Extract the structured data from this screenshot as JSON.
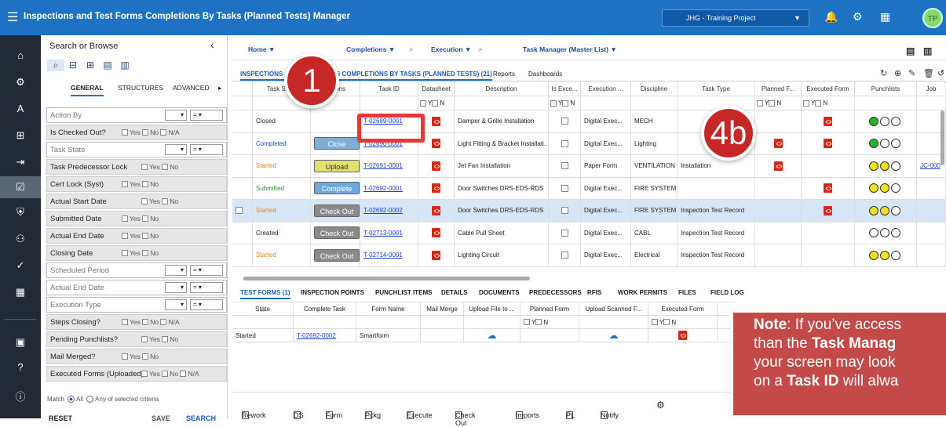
{
  "app": {
    "title": "Inspections and Test Forms Completions By Tasks (Planned Tests) Manager",
    "project": "JHG - Training Project",
    "avatar": "TP"
  },
  "search": {
    "header": "Search or Browse",
    "tabs": [
      "GENERAL",
      "STRUCTURES",
      "ADVANCED"
    ],
    "filters": [
      {
        "label": "Action By",
        "type": "input",
        "op": "="
      },
      {
        "label": "Is Checked Out?",
        "type": "yn",
        "na": true
      },
      {
        "label": "Task State",
        "type": "input",
        "op": "="
      },
      {
        "label": "Task Predecessor Lock",
        "type": "yn",
        "na": false
      },
      {
        "label": "Cert Lock (Syst)",
        "type": "yn",
        "na": false
      },
      {
        "label": "Actual Start Date",
        "type": "yn",
        "na": false
      },
      {
        "label": "Submitted Date",
        "type": "yn",
        "na": false
      },
      {
        "label": "Actual End Date",
        "type": "yn",
        "na": false
      },
      {
        "label": "Closing Date",
        "type": "yn",
        "na": false
      },
      {
        "label": "Scheduled Period",
        "type": "input",
        "op": "="
      },
      {
        "label": "Actual End Date",
        "type": "input",
        "op": "="
      },
      {
        "label": "Execution Type",
        "type": "input",
        "op": "="
      },
      {
        "label": "Steps Closing?",
        "type": "yn",
        "na": true
      },
      {
        "label": "Pending Punchlists?",
        "type": "yn",
        "na": false
      },
      {
        "label": "Mail Merged?",
        "type": "yn",
        "na": false
      },
      {
        "label": "Executed Forms (Uploaded)?",
        "type": "yn",
        "na": true
      }
    ],
    "yes": "Yes",
    "no": "No",
    "na": "N/A",
    "match": {
      "prefix": "Match",
      "all": "All",
      "any": "Any",
      "suffix": "of selected criteria"
    },
    "buttons": {
      "reset": "RESET",
      "save": "SAVE",
      "search": "SEARCH"
    }
  },
  "breadcrumbs": [
    "Home ▼",
    "Completions ▼",
    "Execution ▼",
    "Task Manager (Master List) ▼"
  ],
  "tabs": {
    "main": "INSPECTIONS AND TEST FORMS COMPLETIONS BY TASKS (PLANNED TESTS) (21)",
    "reports": "Reports",
    "dashboards": "Dashboards"
  },
  "grid": {
    "headers": [
      "Task State",
      "Actions",
      "Task ID",
      "Datasheet",
      "Description",
      "Is Exce...",
      "Execution ...",
      "Discipline",
      "Task Type",
      "Planned F...",
      "Executed Form",
      "Punchlists",
      "Job"
    ],
    "filter_yn": "Y",
    "filter_n": "N",
    "rows": [
      {
        "state": "Closed",
        "state_color": "#222",
        "action": "",
        "action_class": "",
        "task_id": "T-02689-0001",
        "description": "Damper & Grille Installation",
        "exec": "Digital Exec...",
        "discipline": "MECH",
        "task_type": "",
        "planned": false,
        "executed": true,
        "lights": [
          "lg",
          "",
          ""
        ],
        "job": ""
      },
      {
        "state": "Completed",
        "state_color": "#1d4ec4",
        "action": "Close",
        "action_class": "close",
        "task_id": "T-02690-0001",
        "description": "Light Fitting & Bracket Installati...",
        "exec": "Digital Exec...",
        "discipline": "Lighting",
        "task_type": "",
        "planned": true,
        "executed": true,
        "lights": [
          "lg",
          "",
          ""
        ],
        "job": ""
      },
      {
        "state": "Started",
        "state_color": "#e8801a",
        "action": "Upload",
        "action_class": "upload",
        "task_id": "T-02691-0001",
        "description": "Jet Fan Installation",
        "exec": "Paper Form",
        "discipline": "VENTILATION",
        "task_type": "Installation",
        "planned": true,
        "executed": false,
        "lights": [
          "ly",
          "ly",
          ""
        ],
        "job": "JC-000"
      },
      {
        "state": "Submitted",
        "state_color": "#2e8b2e",
        "action": "Complete",
        "action_class": "complete",
        "task_id": "T-02692-0001",
        "description": "Door Switches DRS-EDS-RDS",
        "exec": "Digital Exec...",
        "discipline": "FIRE SYSTEM",
        "task_type": "",
        "planned": false,
        "executed": true,
        "lights": [
          "ly",
          "ly",
          ""
        ],
        "job": ""
      },
      {
        "state": "Started",
        "state_color": "#e8801a",
        "action": "Check Out",
        "action_class": "check",
        "task_id": "T-02692-0002",
        "description": "Door Switches DRS-EDS-RDS",
        "exec": "Digital Exec...",
        "discipline": "FIRE SYSTEM",
        "task_type": "Inspection Test Record",
        "planned": false,
        "executed": true,
        "lights": [
          "ly",
          "ly",
          ""
        ],
        "job": "",
        "selected": true
      },
      {
        "state": "Created",
        "state_color": "#222",
        "action": "Check Out",
        "action_class": "check",
        "task_id": "T-02713-0001",
        "description": "Cable Pull Sheet",
        "exec": "Digital Exec...",
        "discipline": "CABL",
        "task_type": "Inspection Test Record",
        "planned": false,
        "executed": false,
        "lights": [
          "",
          "",
          ""
        ],
        "job": ""
      },
      {
        "state": "Started",
        "state_color": "#e8801a",
        "action": "Check Out",
        "action_class": "check",
        "task_id": "T-02714-0001",
        "description": "Lighting Circuit",
        "exec": "Digital Exec...",
        "discipline": "Electrical",
        "task_type": "Inspection Test Record",
        "planned": false,
        "executed": false,
        "lights": [
          "ly",
          "ly",
          ""
        ],
        "job": ""
      }
    ]
  },
  "bottom_tabs": [
    "TEST FORMS (1)",
    "INSPECTION POINTS",
    "PUNCHLIST ITEMS",
    "DETAILS",
    "DOCUMENTS",
    "PREDECESSORS",
    "RFIS",
    "WORK PERMITS",
    "FILES",
    "FIELD LOG"
  ],
  "bgrid": {
    "headers": [
      "State",
      "Complete Task",
      "Form Name",
      "Mail Merge",
      "Upload File to ...",
      "Planned Form",
      "Upload Scanned F...",
      "Executed Form"
    ],
    "row": {
      "state": "Started",
      "task": "T-02692-0002",
      "form": "Smartform"
    }
  },
  "toolbar": [
    "Rework",
    "DS",
    "Form",
    "Pckg",
    "Execute",
    "Check Out",
    "Imports",
    "PL",
    "Notify"
  ],
  "callouts": {
    "one": "1",
    "fourb": "4b"
  },
  "note": {
    "l1a": "Note",
    "l1b": ": If you’ve access",
    "l2a": "than the ",
    "l2b": "Task Manag",
    "l3": "your screen may look",
    "l4a": "on a ",
    "l4b": "Task ID",
    "l4c": " will alwa"
  }
}
